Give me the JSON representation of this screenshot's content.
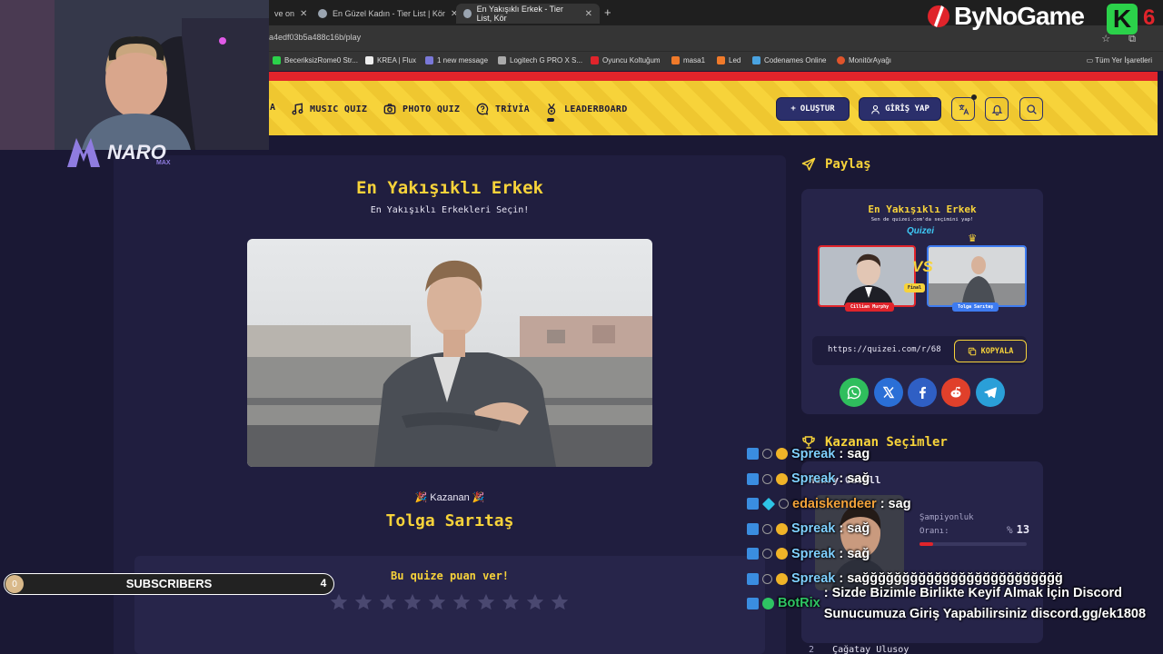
{
  "browser": {
    "tabs": [
      {
        "label": "ve on"
      },
      {
        "label": "En Güzel Kadın - Tier List | Kör "
      },
      {
        "label": "En Yakışıklı Erkek - Tier List, Kör"
      }
    ],
    "url": "a4edf03b5a488c16b/play",
    "bookmarks": [
      "BeceriksizRome0 Str...",
      "KREA | Flux",
      "1 new message",
      "Logitech G PRO X S...",
      "Oyuncu Koltuğum",
      "masa1",
      "Led",
      "Codenames Online",
      "MonitörAyağı"
    ],
    "all_bookmarks": "Tüm Yer İşaretleri"
  },
  "nav": {
    "items": [
      {
        "label": "A"
      },
      {
        "label": "MUSIC QUIZ"
      },
      {
        "label": "PHOTO QUIZ"
      },
      {
        "label": "TRİVİA"
      },
      {
        "label": "LEADERBOARD"
      }
    ],
    "create_label": "OLUŞTUR",
    "login_label": "GİRİŞ YAP"
  },
  "quiz": {
    "title": "En Yakışıklı Erkek",
    "subtitle": "En Yakışıklı Erkekleri Seçin!",
    "winner_label": "Kazanan",
    "winner_name": "Tolga Sarıtaş",
    "rate_title": "Bu quize puan ver!",
    "stars_total": 10
  },
  "share": {
    "heading": "Paylaş",
    "preview_title": "En Yakışıklı Erkek",
    "preview_sub": "Sen de quizei.com'da seçimini yap!",
    "preview_logo": "Quizei",
    "left_tag": "Cillian Murphy",
    "right_tag": "Tolga Sarıtaş",
    "final_tag": "Final",
    "link": "https://quizei.com/r/68",
    "copy_label": "KOPYALA"
  },
  "winners": {
    "heading": "Kazanan Seçimler",
    "first_name": "Henry Cavill",
    "label_line1": "Şampiyonluk",
    "label_line2": "Oranı:",
    "pct_symbol": "%",
    "pct_value": "13",
    "pct_fraction": 0.13,
    "second_name": "Çağatay Ulusoy",
    "second_rank": "2"
  },
  "overlay": {
    "naro": "NARO",
    "naro_sub": "MAX",
    "bynogame": "ByNoGame",
    "k_logo": "K",
    "k_red": "6",
    "subs_left": "0",
    "subs_label": "SUBSCRIBERS",
    "subs_right": "4"
  },
  "chat": [
    {
      "user": "Spreak",
      "msg": ": sag",
      "color": "#7fd0ff"
    },
    {
      "user": "Spreak",
      "msg": ": sağ",
      "color": "#7fd0ff"
    },
    {
      "user": "edaiskendeer",
      "msg": ": sag",
      "color": "#f2a23a"
    },
    {
      "user": "Spreak",
      "msg": ": sağ",
      "color": "#7fd0ff"
    },
    {
      "user": "Spreak",
      "msg": ": sağ",
      "color": "#7fd0ff"
    },
    {
      "user": "Spreak",
      "msg": ": sağğğğğğğğğğğğğğğğğğğğğğğğğ",
      "color": "#7fd0ff"
    },
    {
      "user": "BotRix",
      "msg": ": Sizde Bizimle Birlikte Keyif Almak İçin Discord Sunucumuza Giriş Yapabilirsiniz discord.gg/ek1808",
      "color": "#2ec463"
    }
  ],
  "colors": {
    "accent": "#f7d33a",
    "nav_dark": "#2b2f6b",
    "bg": "#1a1834",
    "red": "#e0242b"
  }
}
